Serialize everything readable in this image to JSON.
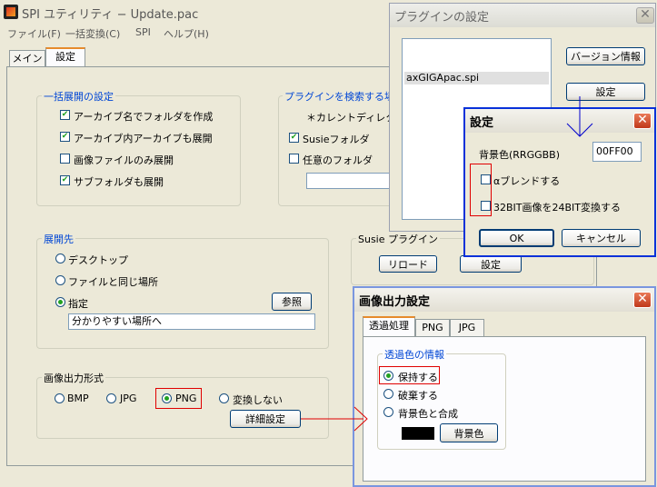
{
  "main_window": {
    "title": "SPI ユティリティ − Update.pac",
    "menu": [
      "ファイル(F)",
      "一括変換(C)",
      "SPI",
      "ヘルプ(H)"
    ],
    "tabs": [
      "メイン",
      "設定"
    ],
    "batch_group": {
      "label": "一括展開の設定",
      "options": [
        {
          "label": "アーカイブ名でフォルダを作成",
          "checked": true
        },
        {
          "label": "アーカイブ内アーカイブも展開",
          "checked": true
        },
        {
          "label": "画像ファイルのみ展開",
          "checked": false
        },
        {
          "label": "サブフォルダも展開",
          "checked": true
        }
      ]
    },
    "plugin_search_group": {
      "label": "プラグインを検索する場所",
      "current_dir": "＊カレントディレクトリ",
      "susie_folder": "Susieフォルダ",
      "any_folder": "任意のフォルダ"
    },
    "dest_group": {
      "label": "展開先",
      "desktop": "デスクトップ",
      "same_place": "ファイルと同じ場所",
      "specify": "指定",
      "browse_button": "参照",
      "path_value": "分かりやすい場所へ"
    },
    "susie_group": {
      "label": "Susie プラグイン",
      "reload_button": "リロード",
      "settings_button": "設定"
    },
    "format_group": {
      "label": "画像出力形式",
      "options": [
        "BMP",
        "JPG",
        "PNG",
        "変換しない"
      ],
      "selected": "PNG",
      "detail_button": "詳細設定"
    }
  },
  "plugin_settings_window": {
    "title": "プラグインの設定",
    "list_items": [
      "axGIGApac.spi"
    ],
    "version_button": "バージョン情報",
    "settings_button": "設定"
  },
  "settings_dialog": {
    "title": "設定",
    "bg_color_label": "背景色(RRGGBB)",
    "bg_color_value": "00FF00",
    "alpha_blend": "αブレンドする",
    "bit_convert": "32BIT画像を24BIT変換する",
    "ok_button": "OK",
    "cancel_button": "キャンセル"
  },
  "image_output_window": {
    "title": "画像出力設定",
    "tabs": [
      "透過処理",
      "PNG",
      "JPG"
    ],
    "group_label": "透過色の情報",
    "keep": "保持する",
    "discard": "破棄する",
    "combine": "背景色と合成",
    "bg_color_button": "背景色",
    "swatch_color": "#000000"
  },
  "colors": {
    "annotation_red": "#E00000",
    "annotation_blue": "#0000CC"
  }
}
